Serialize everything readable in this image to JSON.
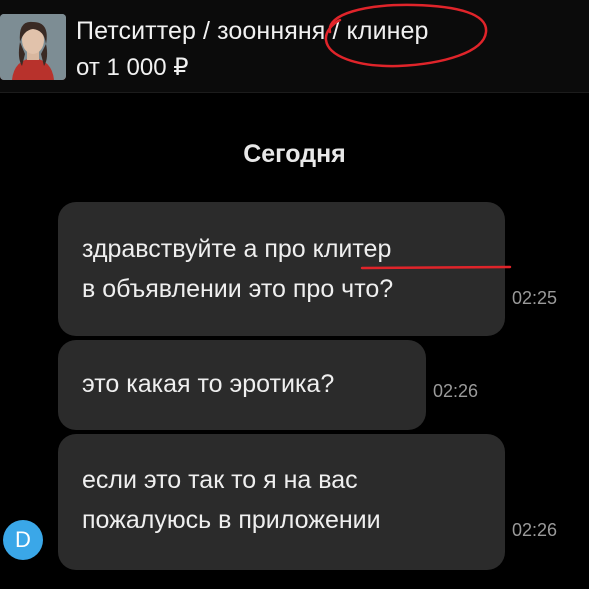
{
  "header": {
    "title": "Петситтер / зоонняня / клинер",
    "price": "от 1 000 ₽",
    "thumbnail_icon": "listing-photo"
  },
  "chat": {
    "date_separator": "Сегодня",
    "messages": [
      {
        "lines": [
          "здравствуйте а про клитер",
          "в объявлении это про что?"
        ],
        "time": "02:25"
      },
      {
        "lines": [
          "это какая то эротика?"
        ],
        "time": "02:26"
      },
      {
        "lines": [
          "если это так то я на вас",
          "пожалуюсь в приложении"
        ],
        "time": "02:26"
      }
    ],
    "sender_avatar_letter": "D"
  },
  "colors": {
    "background": "#000000",
    "bubble": "#2b2b2b",
    "annotation": "#e0242a",
    "avatar": "#3aa7e8"
  }
}
